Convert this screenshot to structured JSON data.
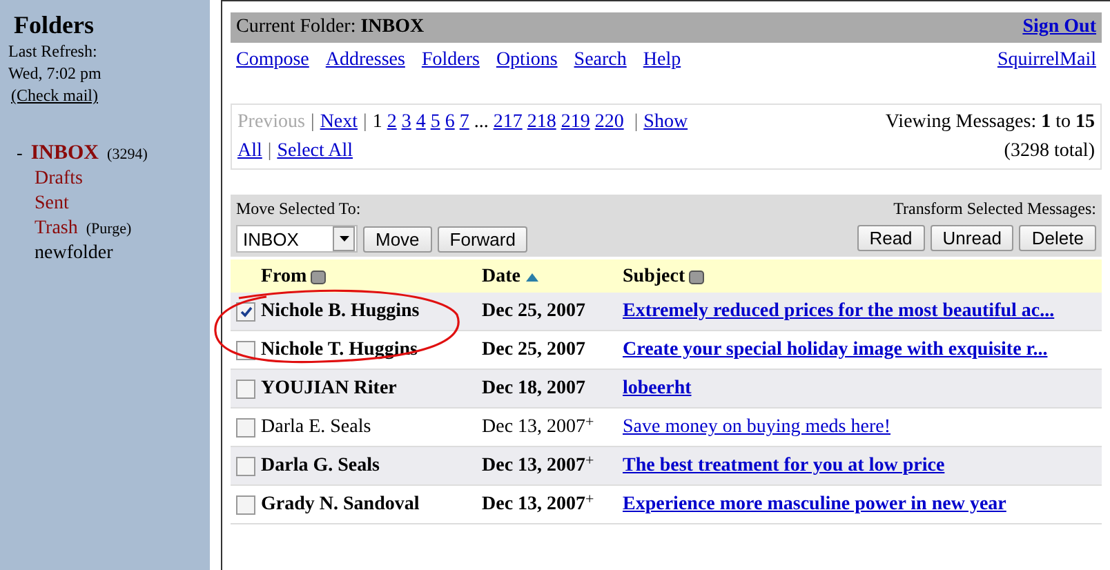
{
  "sidebar": {
    "title": "Folders",
    "refresh_label": "Last Refresh:",
    "refresh_time": "Wed, 7:02 pm",
    "check_mail": "(Check mail)",
    "folders": [
      {
        "marker": "-",
        "name": "INBOX",
        "count": "(3294)",
        "selected": true,
        "kind": "system"
      },
      {
        "name": "Drafts",
        "selected": false,
        "kind": "system"
      },
      {
        "name": "Sent",
        "selected": false,
        "kind": "system"
      },
      {
        "name": "Trash",
        "action": "(Purge)",
        "selected": false,
        "kind": "system"
      },
      {
        "name": "newfolder",
        "selected": false,
        "kind": "user"
      }
    ]
  },
  "header": {
    "folder_label": "Current Folder:",
    "folder": "INBOX",
    "sign_out": "Sign Out"
  },
  "menu": [
    "Compose",
    "Addresses",
    "Folders",
    "Options",
    "Search",
    "Help"
  ],
  "brand_link": "SquirrelMail",
  "pagination": {
    "previous": "Previous",
    "separator": "|",
    "next": "Next",
    "current": "1",
    "pages": [
      "2",
      "3",
      "4",
      "5",
      "6",
      "7"
    ],
    "ellipsis": "...",
    "last_pages": [
      "217",
      "218",
      "219",
      "220"
    ],
    "show_all": [
      "Show",
      "All"
    ],
    "select_all": "Select All",
    "viewing_label": "Viewing Messages:",
    "from": "1",
    "to_word": "to",
    "to": "15",
    "total": "(3298 total)"
  },
  "actions": {
    "move_label": "Move Selected To:",
    "folder_select": "INBOX",
    "buttons_left": [
      "Move",
      "Forward"
    ],
    "transform_label": "Transform Selected Messages:",
    "buttons_right": [
      "Read",
      "Unread",
      "Delete"
    ]
  },
  "columns": [
    {
      "label": "From",
      "sorted": false
    },
    {
      "label": "Date",
      "sorted": true
    },
    {
      "label": "Subject",
      "sorted": false
    }
  ],
  "messages": [
    {
      "from": "Nichole B. Huggins",
      "date": "Dec 25, 2007",
      "subject": "Extremely reduced prices for the most beautiful ac...",
      "unread": true,
      "checked": true
    },
    {
      "from": "Nichole T. Huggins",
      "date": "Dec 25, 2007",
      "subject": "Create your special holiday image with exquisite r...",
      "unread": true,
      "checked": false
    },
    {
      "from": "YOUJIAN Riter",
      "date": "Dec 18, 2007",
      "subject": "lobeerht",
      "unread": true,
      "checked": false
    },
    {
      "from": "Darla E. Seals",
      "date": "Dec 13, 2007",
      "attachment_mark": "+",
      "subject": "Save money on buying meds here!",
      "unread": false,
      "checked": false
    },
    {
      "from": "Darla G. Seals",
      "date": "Dec 13, 2007",
      "attachment_mark": "+",
      "subject": "The best treatment for you at low price",
      "unread": true,
      "checked": false
    },
    {
      "from": "Grady N. Sandoval",
      "date": "Dec 13, 2007",
      "attachment_mark": "+",
      "subject": "Experience more masculine power in new year",
      "unread": true,
      "checked": false
    }
  ]
}
